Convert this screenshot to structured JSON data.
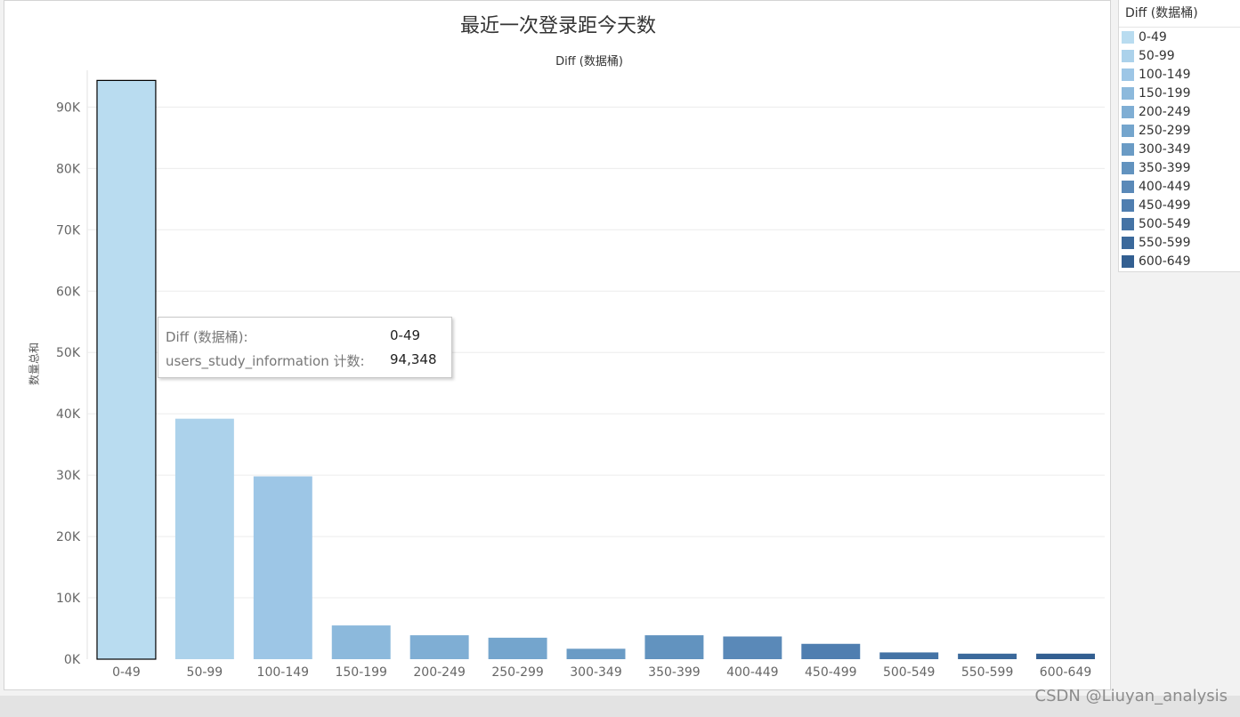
{
  "colors": {
    "bars": [
      "#b9dcf0",
      "#acd2eb",
      "#9dc6e6",
      "#8cb9dc",
      "#7faed4",
      "#74a5cd",
      "#6a9bc5",
      "#6293bf",
      "#5a89b8",
      "#4f7eb0",
      "#4473a5",
      "#3b699b",
      "#335f91"
    ],
    "grid": "#ececec",
    "axis_text": "#666666"
  },
  "chart_data": {
    "type": "bar",
    "title": "最近一次登录距今天数",
    "xlabel": "Diff (数据桶)",
    "ylabel": "数量总和",
    "categories": [
      "0-49",
      "50-99",
      "100-149",
      "150-199",
      "200-249",
      "250-299",
      "300-349",
      "350-399",
      "400-449",
      "450-499",
      "500-549",
      "550-599",
      "600-649"
    ],
    "values": [
      94348,
      39200,
      29800,
      5500,
      3900,
      3500,
      1700,
      3900,
      3700,
      2500,
      1100,
      900,
      900
    ],
    "ylim": [
      0,
      96000
    ],
    "yticks": [
      0,
      10000,
      20000,
      30000,
      40000,
      50000,
      60000,
      70000,
      80000,
      90000
    ],
    "ytick_labels": [
      "0K",
      "10K",
      "20K",
      "30K",
      "40K",
      "50K",
      "60K",
      "70K",
      "80K",
      "90K"
    ],
    "grid": true,
    "legend": "right",
    "selected_index": 0
  },
  "legend": {
    "title": "Diff (数据桶)",
    "items": [
      "0-49",
      "50-99",
      "100-149",
      "150-199",
      "200-249",
      "250-299",
      "300-349",
      "350-399",
      "400-449",
      "450-499",
      "500-549",
      "550-599",
      "600-649"
    ]
  },
  "tooltip": {
    "rows": [
      {
        "label": "Diff (数据桶):",
        "value": "0-49"
      },
      {
        "label": "users_study_information 计数:",
        "value": "94,348"
      }
    ]
  },
  "watermark": "CSDN @Liuyan_analysis"
}
